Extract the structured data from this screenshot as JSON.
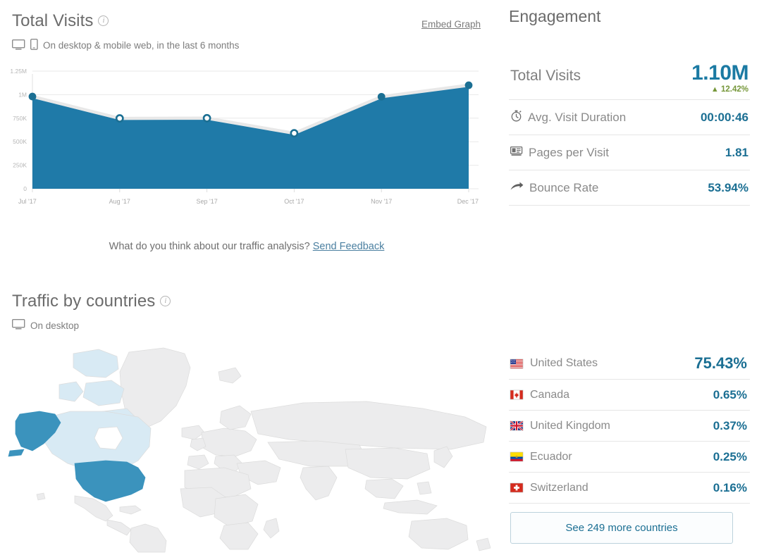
{
  "total_visits_panel": {
    "title": "Total Visits",
    "info_icon": "info-icon",
    "subtitle": "On desktop & mobile web, in the last 6 months",
    "embed_link": "Embed Graph",
    "device_icons": [
      "desktop-icon",
      "mobile-icon"
    ]
  },
  "feedback": {
    "question": "What do you think about our traffic analysis?",
    "link": "Send Feedback"
  },
  "traffic_by_countries_panel": {
    "title": "Traffic by countries",
    "info_icon": "info-icon",
    "subtitle": "On desktop",
    "device_icons": [
      "desktop-icon"
    ]
  },
  "engagement": {
    "title": "Engagement",
    "rows": [
      {
        "label": "Total Visits",
        "value": "1.10M",
        "delta": "12.42%",
        "delta_direction": "up",
        "icon": null
      },
      {
        "label": "Avg. Visit Duration",
        "value": "00:00:46",
        "icon": "stopwatch-icon"
      },
      {
        "label": "Pages per Visit",
        "value": "1.81",
        "icon": "pages-icon"
      },
      {
        "label": "Bounce Rate",
        "value": "53.94%",
        "icon": "arrow-bounce-icon"
      }
    ]
  },
  "countries": {
    "rows": [
      {
        "name": "United States",
        "value": "75.43%",
        "flag": "flag-us"
      },
      {
        "name": "Canada",
        "value": "0.65%",
        "flag": "flag-ca"
      },
      {
        "name": "United Kingdom",
        "value": "0.37%",
        "flag": "flag-gb"
      },
      {
        "name": "Ecuador",
        "value": "0.25%",
        "flag": "flag-ec"
      },
      {
        "name": "Switzerland",
        "value": "0.16%",
        "flag": "flag-ch"
      }
    ],
    "see_more_label": "See 249 more countries"
  },
  "colors": {
    "area_fill": "#1f7aa8",
    "accent_blue": "#1b6f93",
    "delta_green": "#76973a",
    "map_high": "#3b93bd",
    "map_mid": "#d8eaf4",
    "map_low": "#ececed",
    "text_grey": "#8a8a8a"
  },
  "chart_data": {
    "type": "area",
    "title": "Total Visits",
    "xlabel": "",
    "ylabel": "",
    "x": [
      "Jul '17",
      "Aug '17",
      "Sep '17",
      "Oct '17",
      "Nov '17",
      "Dec '17"
    ],
    "categories": [
      "Jul '17",
      "Aug '17",
      "Sep '17",
      "Oct '17",
      "Nov '17",
      "Dec '17"
    ],
    "values": [
      980000,
      748000,
      750000,
      590000,
      978000,
      1100000
    ],
    "ytick_labels": [
      "1.25M",
      "1M",
      "750K",
      "500K",
      "250K",
      "0"
    ],
    "ytick_values": [
      1250000,
      1000000,
      750000,
      500000,
      250000,
      0
    ],
    "ylim": [
      0,
      1250000
    ],
    "grid": true,
    "legend": false,
    "series": [
      {
        "name": "Total Visits",
        "values": [
          980000,
          748000,
          750000,
          590000,
          978000,
          1100000
        ]
      }
    ],
    "markers": [
      {
        "x": "Jul '17",
        "y": 980000,
        "filled": true
      },
      {
        "x": "Aug '17",
        "y": 748000,
        "filled": false
      },
      {
        "x": "Sep '17",
        "y": 750000,
        "filled": false
      },
      {
        "x": "Oct '17",
        "y": 590000,
        "filled": false
      },
      {
        "x": "Nov '17",
        "y": 978000,
        "filled": true
      },
      {
        "x": "Dec '17",
        "y": 1100000,
        "filled": true
      }
    ]
  },
  "map_data": {
    "type": "choropleth",
    "highlighted": [
      {
        "region": "United States",
        "level": "high"
      },
      {
        "region": "Alaska",
        "level": "high"
      },
      {
        "region": "Canada",
        "level": "mid"
      }
    ]
  }
}
